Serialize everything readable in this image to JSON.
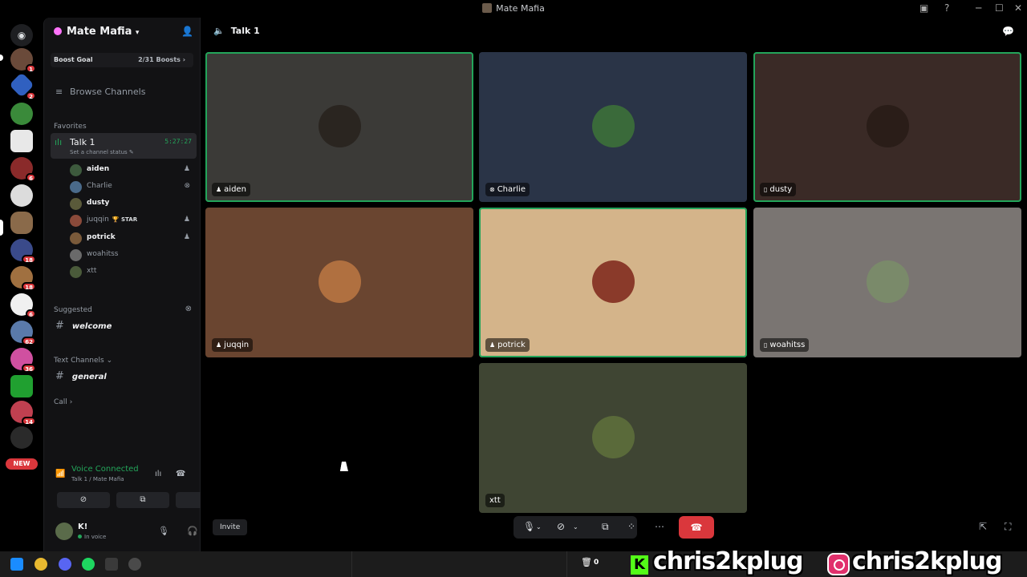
{
  "window": {
    "title": "Mate Mafia"
  },
  "server": {
    "name": "Mate Mafia",
    "boost_label": "Boost Goal",
    "boost_progress": "2/31 Boosts",
    "browse_channels": "Browse Channels",
    "new_badge": "NEW",
    "rail_badges": [
      "1",
      "2",
      "6",
      "18",
      "18",
      "6",
      "62",
      "36",
      "14"
    ]
  },
  "sidebar": {
    "favorites_label": "Favorites",
    "voice_channel": {
      "name": "Talk 1",
      "timer": "5:27:27",
      "status_placeholder": "Set a channel status"
    },
    "members": [
      {
        "name": "aiden",
        "platform": "playstation",
        "color": "#f2f3f5",
        "avatar": "#3d5a3d"
      },
      {
        "name": "Charlie",
        "platform": "xbox",
        "color": "#949ba4",
        "avatar": "#4a6a8a"
      },
      {
        "name": "dusty",
        "platform": "",
        "color": "#f2f3f5",
        "avatar": "#5a5a3a"
      },
      {
        "name": "juqqin",
        "platform": "playstation",
        "color": "#949ba4",
        "avatar": "#8a4a3a",
        "tag": "STAR"
      },
      {
        "name": "potrick",
        "platform": "playstation",
        "color": "#f2f3f5",
        "avatar": "#7a5a3a"
      },
      {
        "name": "woahitss",
        "platform": "",
        "color": "#949ba4",
        "avatar": "#6a6a6a"
      },
      {
        "name": "xtt",
        "platform": "",
        "color": "#949ba4",
        "avatar": "#4a5a3a"
      }
    ],
    "suggested_label": "Suggested",
    "suggested_channel": "welcome",
    "text_channels_label": "Text Channels",
    "text_channel": "general",
    "call_label": "Call"
  },
  "voice_panel": {
    "title": "Voice Connected",
    "subtitle": "Talk 1 / Mate Mafia"
  },
  "user": {
    "name": "K!",
    "status": "In voice"
  },
  "main": {
    "channel_name": "Talk 1",
    "invite_label": "Invite",
    "tiles": [
      {
        "name": "aiden",
        "platform_icon": "playstation-icon",
        "bg": "#3b3a37",
        "avatar": "#2a2520",
        "speaking": true
      },
      {
        "name": "Charlie",
        "platform_icon": "xbox-icon",
        "bg": "#2a3447",
        "avatar": "#3a6a3a",
        "speaking": false
      },
      {
        "name": "dusty",
        "platform_icon": "mobile-icon",
        "bg": "#3a2a26",
        "avatar": "#2a1d18",
        "speaking": true
      },
      {
        "name": "juqqin",
        "platform_icon": "playstation-icon",
        "bg": "#6a4530",
        "avatar": "#b07040",
        "speaking": false
      },
      {
        "name": "potrick",
        "platform_icon": "playstation-icon",
        "bg": "#d4b48a",
        "avatar": "#8a3a2a",
        "speaking": true
      },
      {
        "name": "woahitss",
        "platform_icon": "mobile-icon",
        "bg": "#7a7572",
        "avatar": "#7a8a6a",
        "speaking": false
      },
      {
        "name": "xtt",
        "platform_icon": "",
        "bg": "#3f4533",
        "avatar": "#5a6a3a",
        "speaking": false
      }
    ]
  },
  "taskbar": {
    "counter": "0",
    "watermark_left": "chris2kplug",
    "watermark_right": "chris2kplug"
  }
}
